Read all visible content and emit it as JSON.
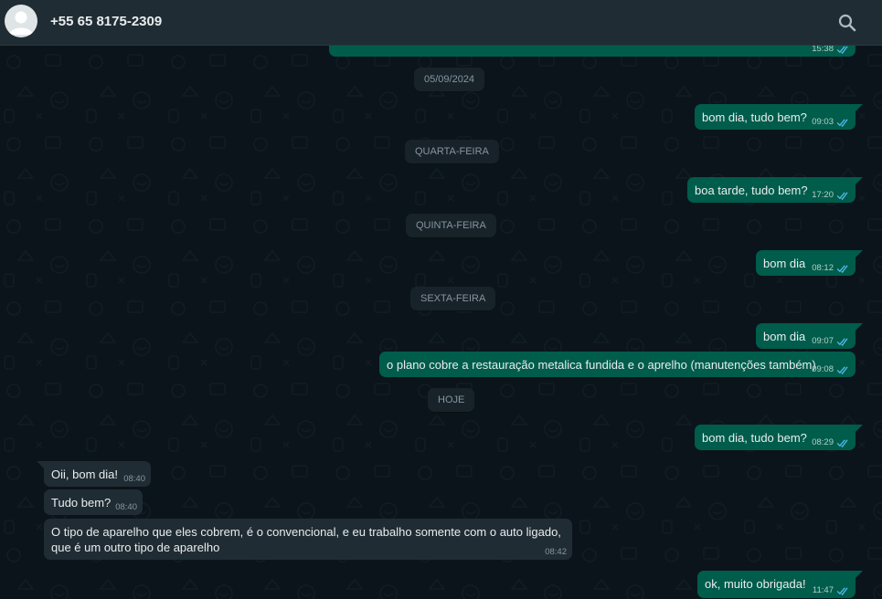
{
  "header": {
    "contact_name": "+55 65 8175-2309"
  },
  "dates": {
    "d1": "05/09/2024",
    "d2": "QUARTA-FEIRA",
    "d3": "QUINTA-FEIRA",
    "d4": "SEXTA-FEIRA",
    "d5": "HOJE"
  },
  "messages": {
    "m0": {
      "time": "15:38"
    },
    "m1": {
      "text": "bom dia, tudo bem?",
      "time": "09:03"
    },
    "m2": {
      "text": "boa tarde, tudo bem?",
      "time": "17:20"
    },
    "m3": {
      "text": "bom dia",
      "time": "08:12"
    },
    "m4": {
      "text": "bom dia",
      "time": "09:07"
    },
    "m5": {
      "text": "o plano cobre a restauração metalica fundida e o aprelho (manutenções também)",
      "time": "09:08"
    },
    "m6": {
      "text": "bom dia, tudo bem?",
      "time": "08:29"
    },
    "m7": {
      "text": "Oii, bom dia!",
      "time": "08:40"
    },
    "m8": {
      "text": "Tudo bem?",
      "time": "08:40"
    },
    "m9": {
      "text": "O tipo de aparelho que eles cobrem, é o convencional, e eu trabalho somente com o auto ligado,\nque é um outro tipo de aparelho",
      "time": "08:42"
    },
    "m10": {
      "text": "ok, muito obrigada!",
      "time": "11:47"
    }
  },
  "colors": {
    "outgoing_bubble": "#005c4b",
    "incoming_bubble": "#202c33",
    "chat_background": "#0b141a",
    "read_ticks": "#53bdeb"
  },
  "icons": {
    "search": "search-icon",
    "avatar": "default-avatar-icon",
    "read_receipt": "double-check-icon"
  }
}
